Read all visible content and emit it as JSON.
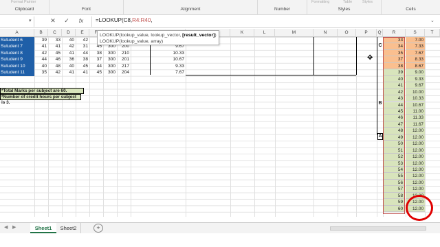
{
  "ribbon": {
    "groups": [
      "Clipboard",
      "Font",
      "Alignment",
      "Number",
      "Styles",
      "Cells"
    ],
    "faint": [
      "Format Painter",
      "Formatting",
      "Table",
      "Styles"
    ]
  },
  "formula_bar": {
    "name_box": "",
    "cancel_icon": "✕",
    "enter_icon": "✓",
    "fx_icon": "fx",
    "formula_prefix": "=LOOKUP(C8,",
    "formula_range": "R4:R40",
    "formula_suffix": ","
  },
  "tooltip": {
    "line1_prefix": "LOOKUP(lookup_value, lookup_vector, ",
    "line1_bold": "[result_vector]",
    "line1_suffix": ")",
    "line2": "LOOKUP(lookup_value, array)"
  },
  "columns": [
    "A",
    "B",
    "C",
    "D",
    "E",
    "F",
    "G",
    "H",
    "I",
    "J",
    "K",
    "L",
    "M",
    "N",
    "O",
    "P",
    "Q",
    "R",
    "S",
    "T"
  ],
  "rows": [
    {
      "name": "Sutudent 6",
      "b": "39",
      "c": "33",
      "d": "40",
      "e": "42",
      "f": "",
      "g": "",
      "h": ""
    },
    {
      "name": "Sutudent 7",
      "b": "41",
      "c": "41",
      "d": "42",
      "e": "31",
      "f": "45",
      "g": "300",
      "h": "200",
      "i": "9.67"
    },
    {
      "name": "Sutudent 8",
      "b": "42",
      "c": "45",
      "d": "41",
      "e": "44",
      "f": "38",
      "g": "300",
      "h": "210",
      "i": "10.33"
    },
    {
      "name": "Sutudent 9",
      "b": "44",
      "c": "46",
      "d": "36",
      "e": "38",
      "f": "37",
      "g": "300",
      "h": "201",
      "i": "10.67"
    },
    {
      "name": "Sutudent 10",
      "b": "40",
      "c": "48",
      "d": "40",
      "e": "45",
      "f": "44",
      "g": "300",
      "h": "217",
      "i": "9.33"
    },
    {
      "name": "Sutudent 11",
      "b": "35",
      "c": "42",
      "d": "41",
      "e": "41",
      "f": "45",
      "g": "300",
      "h": "204",
      "i": "7.67"
    }
  ],
  "notes": [
    "*Total Marks per subject are 60.",
    "*Number of credit hours per subject is 3."
  ],
  "grade_letters": [
    "C",
    "B",
    "A"
  ],
  "lookup_table": [
    {
      "r": "33",
      "s": "7.00",
      "color": "orange"
    },
    {
      "r": "34",
      "s": "7.33",
      "color": "orange"
    },
    {
      "r": "35",
      "s": "7.67",
      "color": "orange"
    },
    {
      "r": "37",
      "s": "8.33",
      "color": "orange"
    },
    {
      "r": "38",
      "s": "8.67",
      "color": "orange"
    },
    {
      "r": "39",
      "s": "9.00",
      "color": "green"
    },
    {
      "r": "40",
      "s": "9.33",
      "color": "green"
    },
    {
      "r": "41",
      "s": "9.67",
      "color": "green"
    },
    {
      "r": "42",
      "s": "10.00",
      "color": "green"
    },
    {
      "r": "43",
      "s": "10.33",
      "color": "green"
    },
    {
      "r": "44",
      "s": "10.67",
      "color": "green"
    },
    {
      "r": "45",
      "s": "11.00",
      "color": "green"
    },
    {
      "r": "46",
      "s": "11.33",
      "color": "green"
    },
    {
      "r": "47",
      "s": "11.67",
      "color": "green"
    },
    {
      "r": "48",
      "s": "12.00",
      "color": "green"
    },
    {
      "r": "49",
      "s": "12.00",
      "color": "green"
    },
    {
      "r": "50",
      "s": "12.00",
      "color": "green"
    },
    {
      "r": "51",
      "s": "12.00",
      "color": "green"
    },
    {
      "r": "52",
      "s": "12.00",
      "color": "green"
    },
    {
      "r": "53",
      "s": "12.00",
      "color": "green"
    },
    {
      "r": "54",
      "s": "12.00",
      "color": "green"
    },
    {
      "r": "55",
      "s": "12.00",
      "color": "green"
    },
    {
      "r": "56",
      "s": "12.00",
      "color": "green"
    },
    {
      "r": "57",
      "s": "12.00",
      "color": "green"
    },
    {
      "r": "58",
      "s": "12.00",
      "color": "green"
    },
    {
      "r": "59",
      "s": "12.00",
      "color": "green"
    },
    {
      "r": "60",
      "s": "12.00",
      "color": "green"
    }
  ],
  "sheet_tabs": [
    "Sheet1",
    "Sheet2"
  ],
  "add_sheet_icon": "+",
  "colors": {
    "orange": "#fabf8f",
    "green": "#d8e4bc",
    "tab_active": "#217346",
    "annotation": "#e00000"
  }
}
